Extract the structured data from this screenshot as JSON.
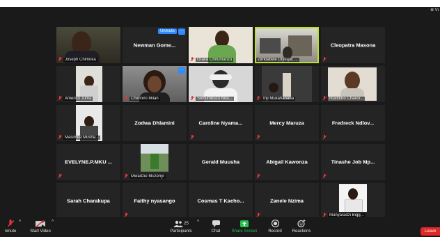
{
  "view_label": "≣ Vi",
  "tiles": [
    {
      "name": "Joseph Chimuka",
      "kind": "video",
      "muted": true
    },
    {
      "name": "Newman Gome...",
      "kind": "name",
      "muted": false,
      "unmute": "Unmute"
    },
    {
      "name": "Grace Chirumanzu",
      "kind": "video",
      "muted": true
    },
    {
      "name": "Zimbabwe Olympic ...",
      "kind": "video",
      "muted": false,
      "active": true
    },
    {
      "name": "Cleopatra Masona",
      "kind": "name",
      "muted": true
    },
    {
      "name": "Americo Juma",
      "kind": "video",
      "muted": true
    },
    {
      "name": "Chidiniro Milan",
      "kind": "video",
      "muted": true
    },
    {
      "name": "Sikhumbuzo Nde...",
      "kind": "video",
      "muted": true
    },
    {
      "name": "Inji Mukahanana",
      "kind": "video",
      "muted": true
    },
    {
      "name": "Ruvimbo Chakor...",
      "kind": "video",
      "muted": true
    },
    {
      "name": "Masimba Musha...",
      "kind": "video",
      "muted": true
    },
    {
      "name": "Zodwa Dhlamini",
      "kind": "name",
      "muted": false
    },
    {
      "name": "Caroline  Nyama...",
      "kind": "name",
      "muted": true
    },
    {
      "name": "Mercy Maruza",
      "kind": "name",
      "muted": true
    },
    {
      "name": "Fredreck  Ndlov...",
      "kind": "name",
      "muted": true
    },
    {
      "name": "EVELYNE.P.MKU ...",
      "kind": "name",
      "muted": true
    },
    {
      "name": "Mwadzie Muzenyi",
      "kind": "video",
      "muted": true
    },
    {
      "name": "Gerald Muusha",
      "kind": "name",
      "muted": false
    },
    {
      "name": "Abigail Kawonza",
      "kind": "name",
      "muted": true
    },
    {
      "name": "Tinashe Job Mp...",
      "kind": "name",
      "muted": true
    },
    {
      "name": "Sarah Charakupa",
      "kind": "name",
      "muted": false
    },
    {
      "name": "Faithy nyasango",
      "kind": "name",
      "muted": true
    },
    {
      "name": "Cosmas T Kacho...",
      "kind": "name",
      "muted": false
    },
    {
      "name": "Zanele Nzima",
      "kind": "name",
      "muted": true
    },
    {
      "name": "Munyaradzi Bigg...",
      "kind": "video",
      "muted": true
    }
  ],
  "toolbar": {
    "unmute": "nmute",
    "start_video": "Start Video",
    "participants": "Participants",
    "participants_count": "25",
    "chat": "Chat",
    "share_screen": "Share Screen",
    "record": "Record",
    "reactions": "Reactions",
    "leave": "Leave"
  },
  "colors": {
    "share_green": "#27c24c",
    "leave_red": "#e02828",
    "active_border": "#b8e02c",
    "unmute_blue": "#2d8cff"
  }
}
